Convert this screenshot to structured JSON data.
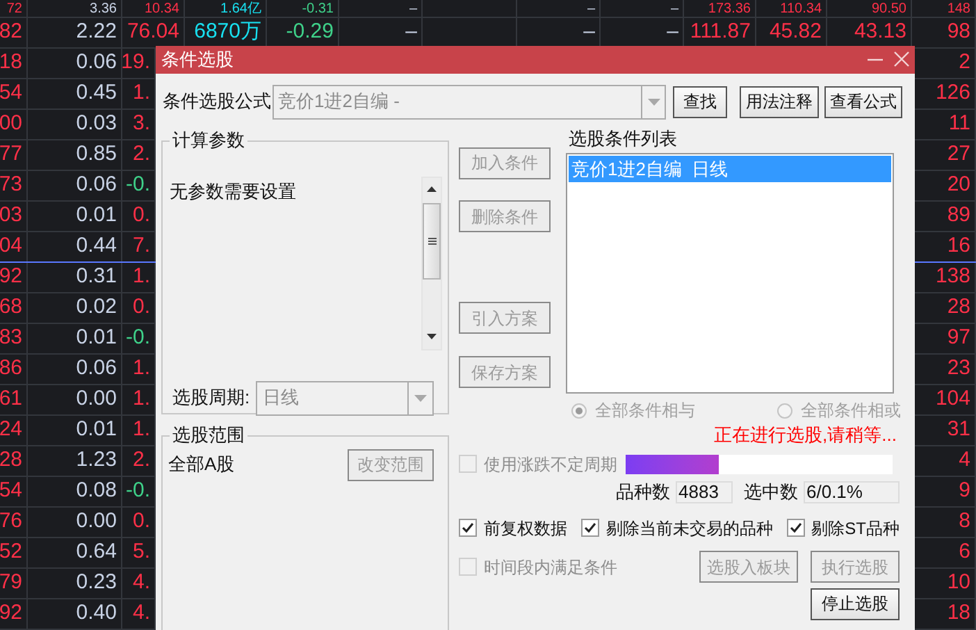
{
  "table": {
    "rows": [
      {
        "kind": "full",
        "divider_below": false,
        "cells": [
          {
            "text": "72",
            "kind": "up"
          },
          {
            "text": "3.36",
            "kind": "plain"
          },
          {
            "text": "10.34",
            "kind": "up"
          },
          {
            "text": "1.64亿",
            "kind": "volume"
          },
          {
            "text": "-0.31",
            "kind": "down"
          },
          {
            "text": "–",
            "kind": "plain"
          },
          {
            "text": "–",
            "kind": "plain"
          },
          {
            "text": "–",
            "kind": "plain"
          },
          {
            "text": "173.36",
            "kind": "up"
          },
          {
            "text": "110.34",
            "kind": "up"
          },
          {
            "text": "90.50",
            "kind": "up"
          },
          {
            "text": "148",
            "kind": "up"
          }
        ]
      },
      {
        "kind": "full",
        "divider_below": false,
        "cells": [
          {
            "text": "82",
            "kind": "up"
          },
          {
            "text": "2.22",
            "kind": "plain"
          },
          {
            "text": "76.04",
            "kind": "up"
          },
          {
            "text": "6870万",
            "kind": "volume"
          },
          {
            "text": "-0.29",
            "kind": "down"
          },
          {
            "text": "–",
            "kind": "plain"
          },
          {
            "text": "–",
            "kind": "plain"
          },
          {
            "text": "–",
            "kind": "plain"
          },
          {
            "text": "111.87",
            "kind": "up"
          },
          {
            "text": "45.82",
            "kind": "up"
          },
          {
            "text": "43.13",
            "kind": "up"
          },
          {
            "text": "98",
            "kind": "up"
          }
        ]
      },
      {
        "kind": "covered",
        "divider_below": false,
        "cells": [
          {
            "text": "18",
            "kind": "up"
          },
          {
            "text": "0.06",
            "kind": "plain"
          },
          {
            "text": "19.",
            "kind": "up"
          },
          {
            "text": "2",
            "kind": "up"
          }
        ]
      },
      {
        "kind": "covered",
        "divider_below": false,
        "cells": [
          {
            "text": "54",
            "kind": "up"
          },
          {
            "text": "0.45",
            "kind": "plain"
          },
          {
            "text": "1.",
            "kind": "up"
          },
          {
            "text": "126",
            "kind": "up"
          }
        ]
      },
      {
        "kind": "covered",
        "divider_below": false,
        "cells": [
          {
            "text": "00",
            "kind": "up"
          },
          {
            "text": "0.03",
            "kind": "plain"
          },
          {
            "text": "3.",
            "kind": "up"
          },
          {
            "text": "11",
            "kind": "up"
          }
        ]
      },
      {
        "kind": "covered",
        "divider_below": false,
        "cells": [
          {
            "text": "77",
            "kind": "up"
          },
          {
            "text": "0.85",
            "kind": "plain"
          },
          {
            "text": "2.",
            "kind": "up"
          },
          {
            "text": "27",
            "kind": "up"
          }
        ]
      },
      {
        "kind": "covered",
        "divider_below": false,
        "cells": [
          {
            "text": "73",
            "kind": "up"
          },
          {
            "text": "0.06",
            "kind": "plain"
          },
          {
            "text": "-0.",
            "kind": "down"
          },
          {
            "text": "20",
            "kind": "up"
          }
        ]
      },
      {
        "kind": "covered",
        "divider_below": false,
        "cells": [
          {
            "text": "03",
            "kind": "up"
          },
          {
            "text": "0.01",
            "kind": "plain"
          },
          {
            "text": "0.",
            "kind": "up"
          },
          {
            "text": "89",
            "kind": "up"
          }
        ]
      },
      {
        "kind": "covered",
        "divider_below": true,
        "cells": [
          {
            "text": "04",
            "kind": "up"
          },
          {
            "text": "0.44",
            "kind": "plain"
          },
          {
            "text": "7.",
            "kind": "up"
          },
          {
            "text": "16",
            "kind": "up"
          }
        ]
      },
      {
        "kind": "covered",
        "divider_below": false,
        "cells": [
          {
            "text": "92",
            "kind": "up"
          },
          {
            "text": "0.31",
            "kind": "plain"
          },
          {
            "text": "1.",
            "kind": "up"
          },
          {
            "text": "138",
            "kind": "up"
          }
        ]
      },
      {
        "kind": "covered",
        "divider_below": false,
        "cells": [
          {
            "text": "68",
            "kind": "up"
          },
          {
            "text": "0.02",
            "kind": "plain"
          },
          {
            "text": "0.",
            "kind": "up"
          },
          {
            "text": "28",
            "kind": "up"
          }
        ]
      },
      {
        "kind": "covered",
        "divider_below": false,
        "cells": [
          {
            "text": "83",
            "kind": "up"
          },
          {
            "text": "0.01",
            "kind": "plain"
          },
          {
            "text": "-0.",
            "kind": "down"
          },
          {
            "text": "97",
            "kind": "up"
          }
        ]
      },
      {
        "kind": "covered",
        "divider_below": false,
        "cells": [
          {
            "text": "86",
            "kind": "up"
          },
          {
            "text": "0.06",
            "kind": "plain"
          },
          {
            "text": "1.",
            "kind": "up"
          },
          {
            "text": "23",
            "kind": "up"
          }
        ]
      },
      {
        "kind": "covered",
        "divider_below": false,
        "cells": [
          {
            "text": "61",
            "kind": "up"
          },
          {
            "text": "0.00",
            "kind": "plain"
          },
          {
            "text": "1.",
            "kind": "up"
          },
          {
            "text": "104",
            "kind": "up"
          }
        ]
      },
      {
        "kind": "covered",
        "divider_below": false,
        "cells": [
          {
            "text": "24",
            "kind": "up"
          },
          {
            "text": "0.01",
            "kind": "plain"
          },
          {
            "text": "1.",
            "kind": "up"
          },
          {
            "text": "31",
            "kind": "up"
          }
        ]
      },
      {
        "kind": "covered",
        "divider_below": false,
        "cells": [
          {
            "text": "28",
            "kind": "up"
          },
          {
            "text": "1.23",
            "kind": "plain"
          },
          {
            "text": "2.",
            "kind": "up"
          },
          {
            "text": "4",
            "kind": "up"
          }
        ]
      },
      {
        "kind": "covered",
        "divider_below": false,
        "cells": [
          {
            "text": "54",
            "kind": "up"
          },
          {
            "text": "0.08",
            "kind": "plain"
          },
          {
            "text": "-0.",
            "kind": "down"
          },
          {
            "text": "9",
            "kind": "up"
          }
        ]
      },
      {
        "kind": "covered",
        "divider_below": false,
        "cells": [
          {
            "text": "76",
            "kind": "up"
          },
          {
            "text": "0.00",
            "kind": "plain"
          },
          {
            "text": "0.",
            "kind": "up"
          },
          {
            "text": "8",
            "kind": "up"
          }
        ]
      },
      {
        "kind": "covered",
        "divider_below": false,
        "cells": [
          {
            "text": "52",
            "kind": "up"
          },
          {
            "text": "0.64",
            "kind": "plain"
          },
          {
            "text": "5.",
            "kind": "up"
          },
          {
            "text": "6",
            "kind": "up"
          }
        ]
      },
      {
        "kind": "covered",
        "divider_below": false,
        "cells": [
          {
            "text": "79",
            "kind": "up"
          },
          {
            "text": "0.23",
            "kind": "plain"
          },
          {
            "text": "4.",
            "kind": "up"
          },
          {
            "text": "10",
            "kind": "up"
          }
        ]
      },
      {
        "kind": "covered",
        "divider_below": false,
        "cells": [
          {
            "text": "92",
            "kind": "up"
          },
          {
            "text": "0.40",
            "kind": "plain"
          },
          {
            "text": "4.",
            "kind": "up"
          },
          {
            "text": "18",
            "kind": "up"
          }
        ]
      }
    ]
  },
  "dialog": {
    "title": "条件选股",
    "formula": {
      "label": "条件选股公式",
      "value": "竞价1进2自编 -",
      "disabled": true
    },
    "top_buttons": [
      {
        "label": "查找",
        "disabled": false
      },
      {
        "label": "用法注释",
        "disabled": false
      },
      {
        "label": "查看公式",
        "disabled": false
      }
    ],
    "params": {
      "title": "计算参数",
      "message": "无参数需要设置",
      "period_label": "选股周期:",
      "period_value": "日线",
      "period_disabled": true
    },
    "side_buttons": [
      {
        "label": "加入条件",
        "disabled": true
      },
      {
        "label": "删除条件",
        "disabled": true
      },
      {
        "label": "引入方案",
        "disabled": true
      },
      {
        "label": "保存方案",
        "disabled": true
      }
    ],
    "conditions": {
      "title": "选股条件列表",
      "items": [
        {
          "label": "竞价1进2自编  日线",
          "selected": true
        }
      ]
    },
    "logic": [
      {
        "label": "全部条件相与",
        "selected": true,
        "disabled": true
      },
      {
        "label": "全部条件相或",
        "selected": false,
        "disabled": true
      }
    ],
    "range": {
      "title": "选股范围",
      "value": "全部A股",
      "button": {
        "label": "改变范围",
        "disabled": true
      }
    },
    "status": "正在进行选股,请稍等...",
    "variable_period": {
      "label": "使用涨跌不定周期",
      "checked": false,
      "disabled": true
    },
    "progress": {
      "level": 0.35
    },
    "counts": [
      {
        "label": "品种数",
        "value": "4883"
      },
      {
        "label": "选中数",
        "value": "6/0.1%"
      }
    ],
    "options": [
      {
        "label": "前复权数据",
        "checked": true
      },
      {
        "label": "剔除当前未交易的品种",
        "checked": true
      },
      {
        "label": "剔除ST品种",
        "checked": true
      }
    ],
    "time_range": {
      "label": "时间段内满足条件",
      "checked": false,
      "disabled": true
    },
    "action_buttons": [
      {
        "label": "选股入板块",
        "disabled": true
      },
      {
        "label": "执行选股",
        "disabled": true
      }
    ],
    "stop_button": {
      "label": "停止选股",
      "disabled": false
    }
  }
}
